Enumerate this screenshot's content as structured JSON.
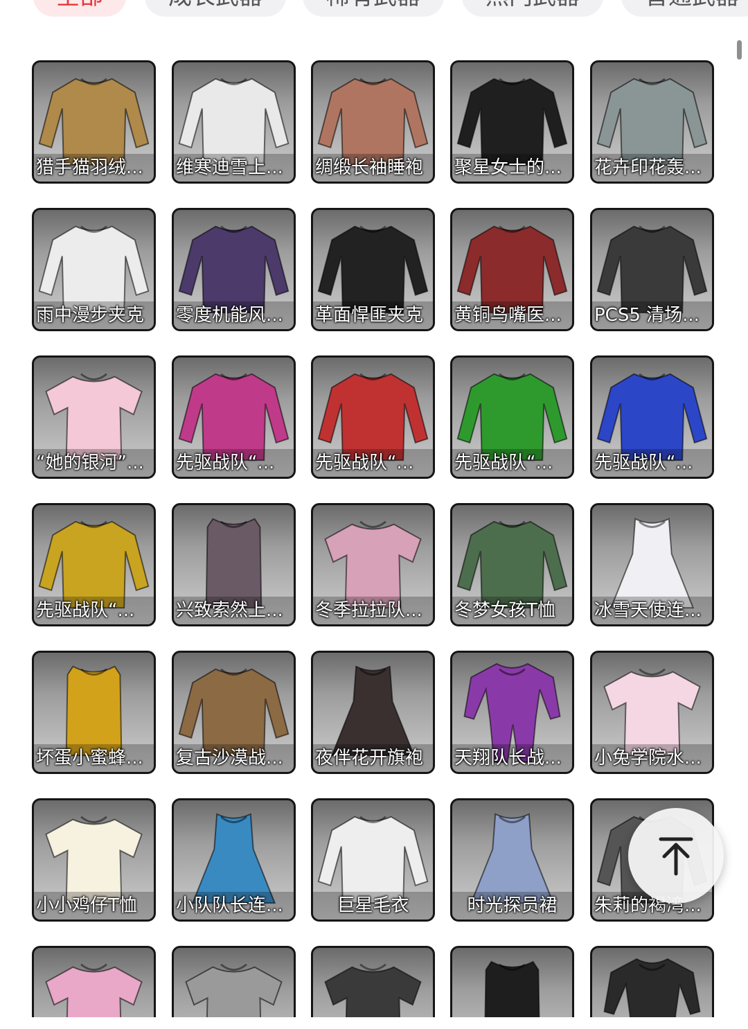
{
  "tabs": [
    {
      "label": "全部",
      "active": true
    },
    {
      "label": "成长武器",
      "active": false
    },
    {
      "label": "稀有武器",
      "active": false
    },
    {
      "label": "热门武器",
      "active": false
    },
    {
      "label": "普通武器",
      "active": false
    }
  ],
  "items": [
    {
      "name": "猎手猫羽绒...",
      "color": "#b08a4a",
      "icon": "puffer-jacket-icon"
    },
    {
      "name": "维寒迪雪上...",
      "color": "#e9e9e9",
      "icon": "snow-jacket-icon"
    },
    {
      "name": "绸缎长袖睡袍",
      "color": "#b07560",
      "icon": "satin-robe-icon"
    },
    {
      "name": "聚星女士的...",
      "color": "#1f1f1f",
      "icon": "leather-jacket-icon"
    },
    {
      "name": "花卉印花轰...",
      "color": "#8a9696",
      "icon": "floral-bomber-icon"
    },
    {
      "name": "雨中漫步夹克",
      "color": "#ececec",
      "icon": "hooded-jacket-icon"
    },
    {
      "name": "零度机能风...",
      "color": "#4b3a6a",
      "icon": "tech-jacket-icon"
    },
    {
      "name": "革面悍匪夹克",
      "color": "#222222",
      "icon": "leather-coat-icon"
    },
    {
      "name": "黄铜鸟嘴医...",
      "color": "#8c2b2b",
      "icon": "doctor-coat-icon"
    },
    {
      "name": "PCS5 清场...",
      "color": "#3a3a3a",
      "icon": "long-sleeve-tee-icon"
    },
    {
      "name": "“她的银河”...",
      "color": "#f4c8d6",
      "icon": "t-shirt-icon"
    },
    {
      "name": "先驱战队“...",
      "color": "#c03a8a",
      "icon": "racing-top-icon"
    },
    {
      "name": "先驱战队“...",
      "color": "#c03232",
      "icon": "racing-top-icon"
    },
    {
      "name": "先驱战队“...",
      "color": "#2e9a2e",
      "icon": "racing-top-icon"
    },
    {
      "name": "先驱战队“...",
      "color": "#2c46c8",
      "icon": "racing-top-icon"
    },
    {
      "name": "先驱战队“...",
      "color": "#c9a421",
      "icon": "racing-top-icon"
    },
    {
      "name": "兴致索然上...",
      "color": "#6a5a66",
      "icon": "tank-top-icon"
    },
    {
      "name": "冬季拉拉队...",
      "color": "#d7a1b8",
      "icon": "cheer-top-icon"
    },
    {
      "name": "冬梦女孩T恤",
      "color": "#4d6e4d",
      "icon": "sweater-icon"
    },
    {
      "name": "冰雪天使连...",
      "color": "#f0f0f4",
      "icon": "dress-icon"
    },
    {
      "name": "坏蛋小蜜蜂...",
      "color": "#d3a21b",
      "icon": "vest-icon"
    },
    {
      "name": "复古沙漠战...",
      "color": "#8c6a44",
      "icon": "desert-jacket-icon"
    },
    {
      "name": "夜伴花开旗袍",
      "color": "#3a3030",
      "icon": "qipao-icon"
    },
    {
      "name": "天翔队长战...",
      "color": "#8a3aa8",
      "icon": "bodysuit-icon"
    },
    {
      "name": "小兔学院水...",
      "color": "#f5d7e3",
      "icon": "sailor-top-icon"
    },
    {
      "name": "小小鸡仔T恤",
      "color": "#f7f2e0",
      "icon": "t-shirt-icon"
    },
    {
      "name": "小队队长连...",
      "color": "#3a8ac2",
      "icon": "cheer-dress-icon"
    },
    {
      "name": "巨星毛衣",
      "color": "#eeeeee",
      "icon": "sweater-icon"
    },
    {
      "name": "时光探员裙",
      "color": "#8ea0c8",
      "icon": "dress-icon"
    },
    {
      "name": "朱莉的褐湾...",
      "color": "#555555",
      "icon": "coat-icon"
    },
    {
      "name": "",
      "color": "#e9a8c8",
      "icon": "t-shirt-icon"
    },
    {
      "name": "",
      "color": "#9a9a9a",
      "icon": "crop-top-icon"
    },
    {
      "name": "",
      "color": "#3a3a3a",
      "icon": "lace-top-icon"
    },
    {
      "name": "",
      "color": "#1e1e1e",
      "icon": "tank-top-icon"
    },
    {
      "name": "",
      "color": "#2a2a2a",
      "icon": "bodysuit-icon"
    }
  ],
  "back_to_top": {
    "icon": "arrow-up-to-top-icon"
  }
}
